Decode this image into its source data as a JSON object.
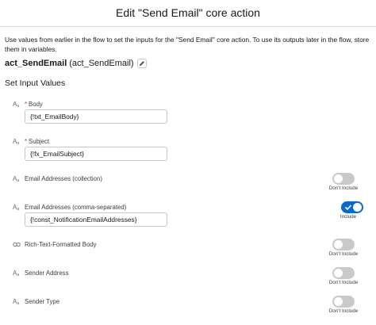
{
  "header": {
    "title": "Edit \"Send Email\" core action"
  },
  "intro": "Use values from earlier in the flow to set the inputs for the \"Send Email\" core action. To use its outputs later in the flow, store them in variables.",
  "action": {
    "api_name": "act_SendEmail",
    "label": "(act_SendEmail)"
  },
  "section": {
    "title": "Set Input Values"
  },
  "type_icon": "Aa",
  "rich_text_icon": "link-icon",
  "params": [
    {
      "label": "Body",
      "required": "*",
      "value": "{!txt_EmailBody}"
    },
    {
      "label": "Subject",
      "required": "*",
      "value": "{!fx_EmailSubject}"
    },
    {
      "label": "Email Addresses (collection)",
      "toggle": "Don't Include"
    },
    {
      "label": "Email Addresses (comma-separated)",
      "value": "{!const_NotificationEmailAddresses}",
      "toggle": "Include"
    },
    {
      "label": "Rich-Text-Formatted Body",
      "toggle": "Don't Include"
    },
    {
      "label": "Sender Address",
      "toggle": "Don't Include"
    },
    {
      "label": "Sender Type",
      "toggle": "Don't Include"
    }
  ],
  "colors": {
    "toggle_on": "#0b6ac6",
    "toggle_off": "#c9c9c9",
    "required": "#c23934"
  }
}
